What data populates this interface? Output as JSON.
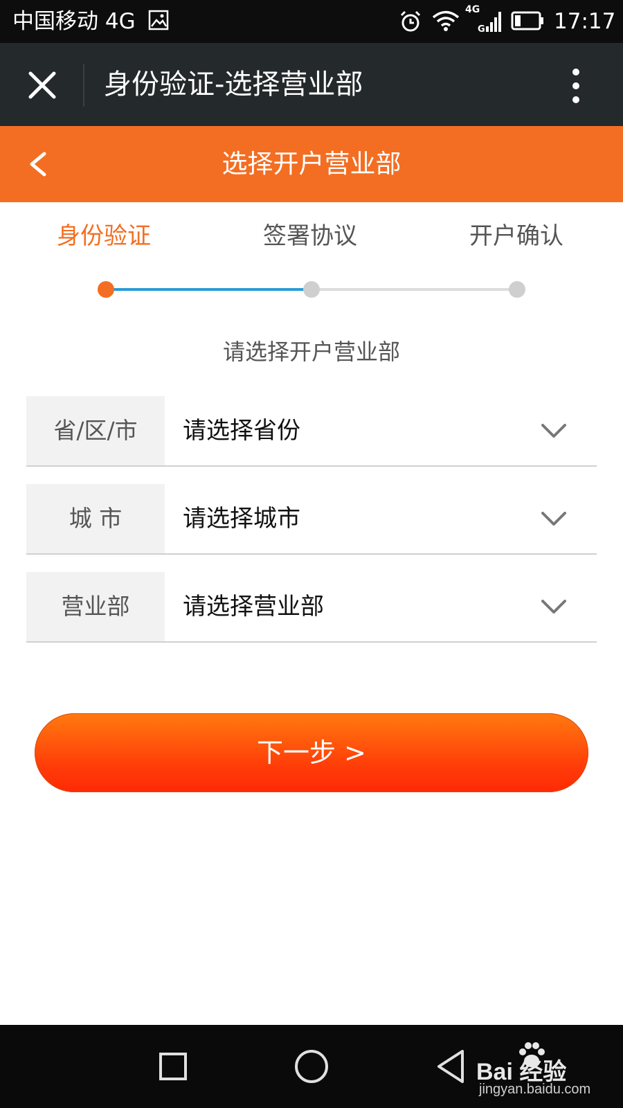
{
  "status_bar": {
    "carrier": "中国移动 4G",
    "network": "4G",
    "time": "17:17",
    "icons": [
      "image-icon",
      "alarm-icon",
      "wifi-icon",
      "signal-icon",
      "battery-icon"
    ]
  },
  "app_header": {
    "title": "身份验证-选择营业部",
    "close_icon": "close-icon",
    "more_icon": "more-vertical-icon"
  },
  "nav_bar": {
    "title": "选择开户营业部",
    "back_icon": "back-chevron-icon",
    "background": "#f36e22"
  },
  "steps": [
    {
      "label": "身份验证",
      "state": "current"
    },
    {
      "label": "签署协议",
      "state": "pending"
    },
    {
      "label": "开户确认",
      "state": "pending"
    }
  ],
  "prompt": "请选择开户营业部",
  "form": {
    "rows": [
      {
        "label": "省/区/市",
        "value": "请选择省份"
      },
      {
        "label": "城 市",
        "value": "请选择城市"
      },
      {
        "label": "营业部",
        "value": "请选择营业部"
      }
    ]
  },
  "next_button": {
    "label": "下一步 >"
  },
  "watermark": {
    "brand": "Bai 经验",
    "url": "jingyan.baidu.com"
  },
  "colors": {
    "accent": "#f36e22",
    "progress_line": "#2a9bd7",
    "button_gradient_top": "#ff7a10",
    "button_gradient_bottom": "#ff2a05",
    "header_dark": "#24292b"
  }
}
